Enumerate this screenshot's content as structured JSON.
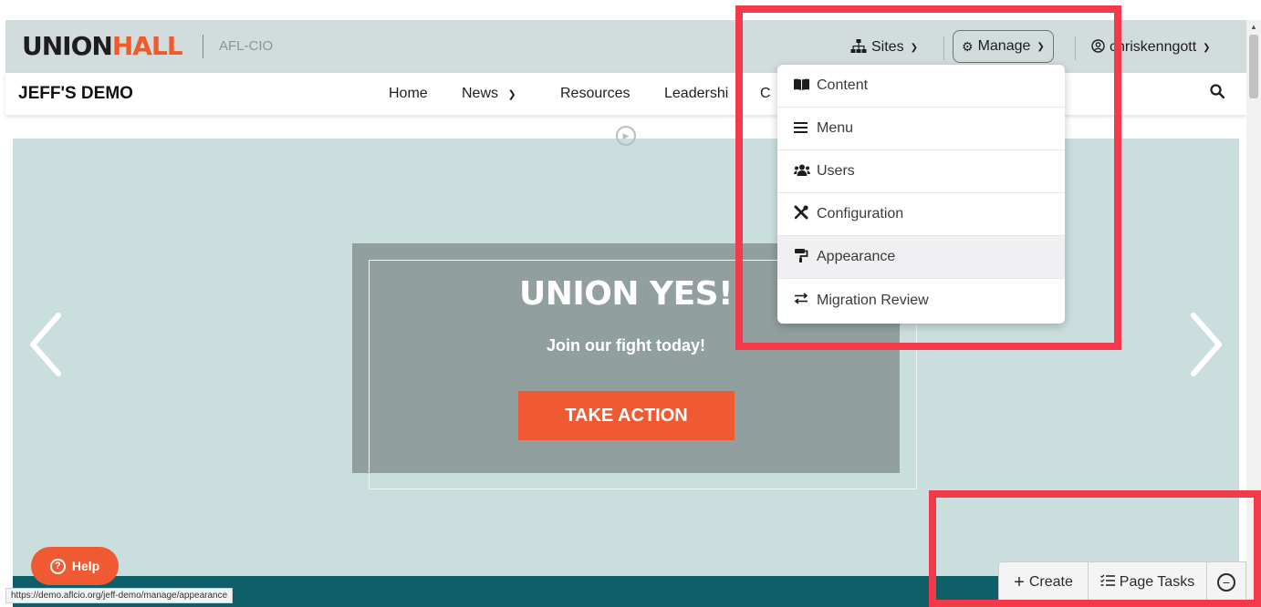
{
  "brand": {
    "logo_union": "UNION",
    "logo_hall": "HALL",
    "org": "AFL-CIO"
  },
  "topbar": {
    "sites_label": "Sites",
    "manage_label": "Manage",
    "user_label": "chriskenngott"
  },
  "site_nav": {
    "title": "JEFF'S DEMO",
    "items": [
      "Home",
      "News",
      "Resources",
      "Leadershi",
      "C"
    ]
  },
  "manage_menu": {
    "items": [
      {
        "label": "Content",
        "icon": "book-icon"
      },
      {
        "label": "Menu",
        "icon": "hamburger-icon"
      },
      {
        "label": "Users",
        "icon": "users-icon"
      },
      {
        "label": "Configuration",
        "icon": "tools-icon"
      },
      {
        "label": "Appearance",
        "icon": "paint-roller-icon"
      },
      {
        "label": "Migration Review",
        "icon": "swap-arrows-icon"
      }
    ],
    "active_index": 4
  },
  "hero": {
    "title": "UNION YES!",
    "subtitle": "Join our fight today!",
    "cta": "TAKE ACTION"
  },
  "help": {
    "label": "Help"
  },
  "status_url": "https://demo.aflcio.org/jeff-demo/manage/appearance",
  "page_tasks": {
    "create": "Create",
    "page_tasks": "Page Tasks"
  },
  "colors": {
    "brand_orange": "#f05a28",
    "topbar_bg": "#d2dcdc",
    "hero_bg": "#cadedd",
    "card_bg": "#919f9f",
    "highlight_red": "#f4394a",
    "footer_teal": "#0f5f68"
  }
}
